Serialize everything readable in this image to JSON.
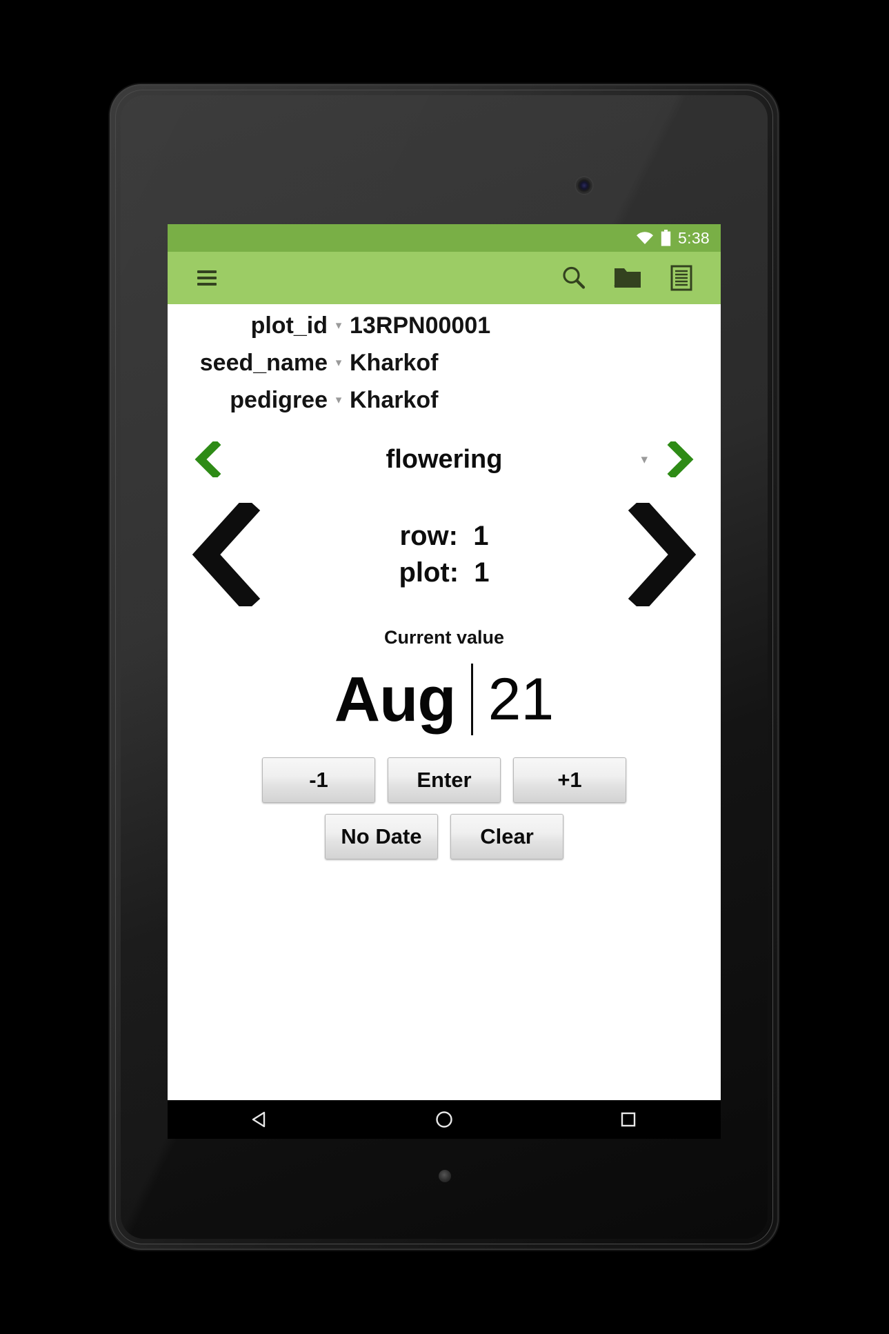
{
  "status_bar": {
    "time": "5:38",
    "wifi_icon": "wifi-icon",
    "battery_icon": "battery-icon"
  },
  "action_bar": {
    "menu_icon": "hamburger-menu-icon",
    "search_icon": "search-icon",
    "folder_icon": "folder-icon",
    "list_icon": "list-icon",
    "background_color": "#9ccc65",
    "status_background_color": "#79af46"
  },
  "fields": [
    {
      "label": "plot_id",
      "caret": "▾",
      "value": "13RPN00001"
    },
    {
      "label": "seed_name",
      "caret": "▾",
      "value": "Kharkof"
    },
    {
      "label": "pedigree",
      "caret": "▾",
      "value": "Kharkof"
    }
  ],
  "trait_selector": {
    "prev_icon": "chevron-left-icon",
    "next_icon": "chevron-right-icon",
    "name": "flowering",
    "caret": "▾",
    "chevron_color": "#2e8b16"
  },
  "plot_nav": {
    "prev_icon": "chevron-left-icon",
    "next_icon": "chevron-right-icon",
    "row_line": "row:  1",
    "plot_line": "plot:  1",
    "chevron_color": "#0d0d0d"
  },
  "current_value": {
    "label": "Current value",
    "month": "Aug",
    "day": "21"
  },
  "buttons": {
    "row1": [
      {
        "label": "-1",
        "name": "decrement-button"
      },
      {
        "label": "Enter",
        "name": "enter-button"
      },
      {
        "label": "+1",
        "name": "increment-button"
      }
    ],
    "row2": [
      {
        "label": "No Date",
        "name": "no-date-button"
      },
      {
        "label": "Clear",
        "name": "clear-button"
      }
    ]
  },
  "android_nav": {
    "back_icon": "back-triangle-icon",
    "home_icon": "home-circle-icon",
    "recents_icon": "recents-square-icon"
  }
}
